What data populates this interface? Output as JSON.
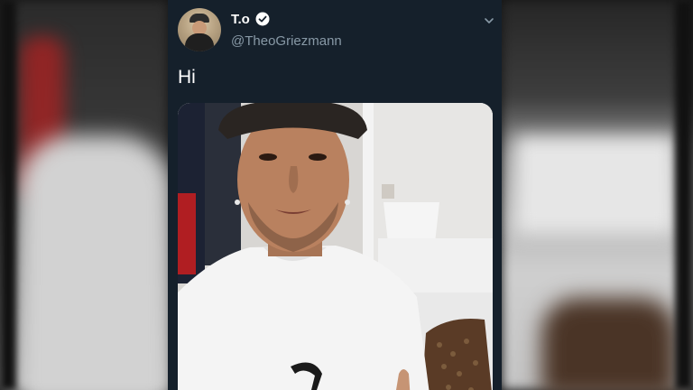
{
  "tweet": {
    "display_name": "T.o",
    "handle": "@TheoGriezmann",
    "text": "Hi",
    "verified": true
  },
  "icons": {
    "verified": "verified-badge-icon",
    "more": "chevron-down-icon"
  },
  "colors": {
    "card_background": "#15202b",
    "primary_text": "#ffffff",
    "secondary_text": "#8899a6"
  }
}
